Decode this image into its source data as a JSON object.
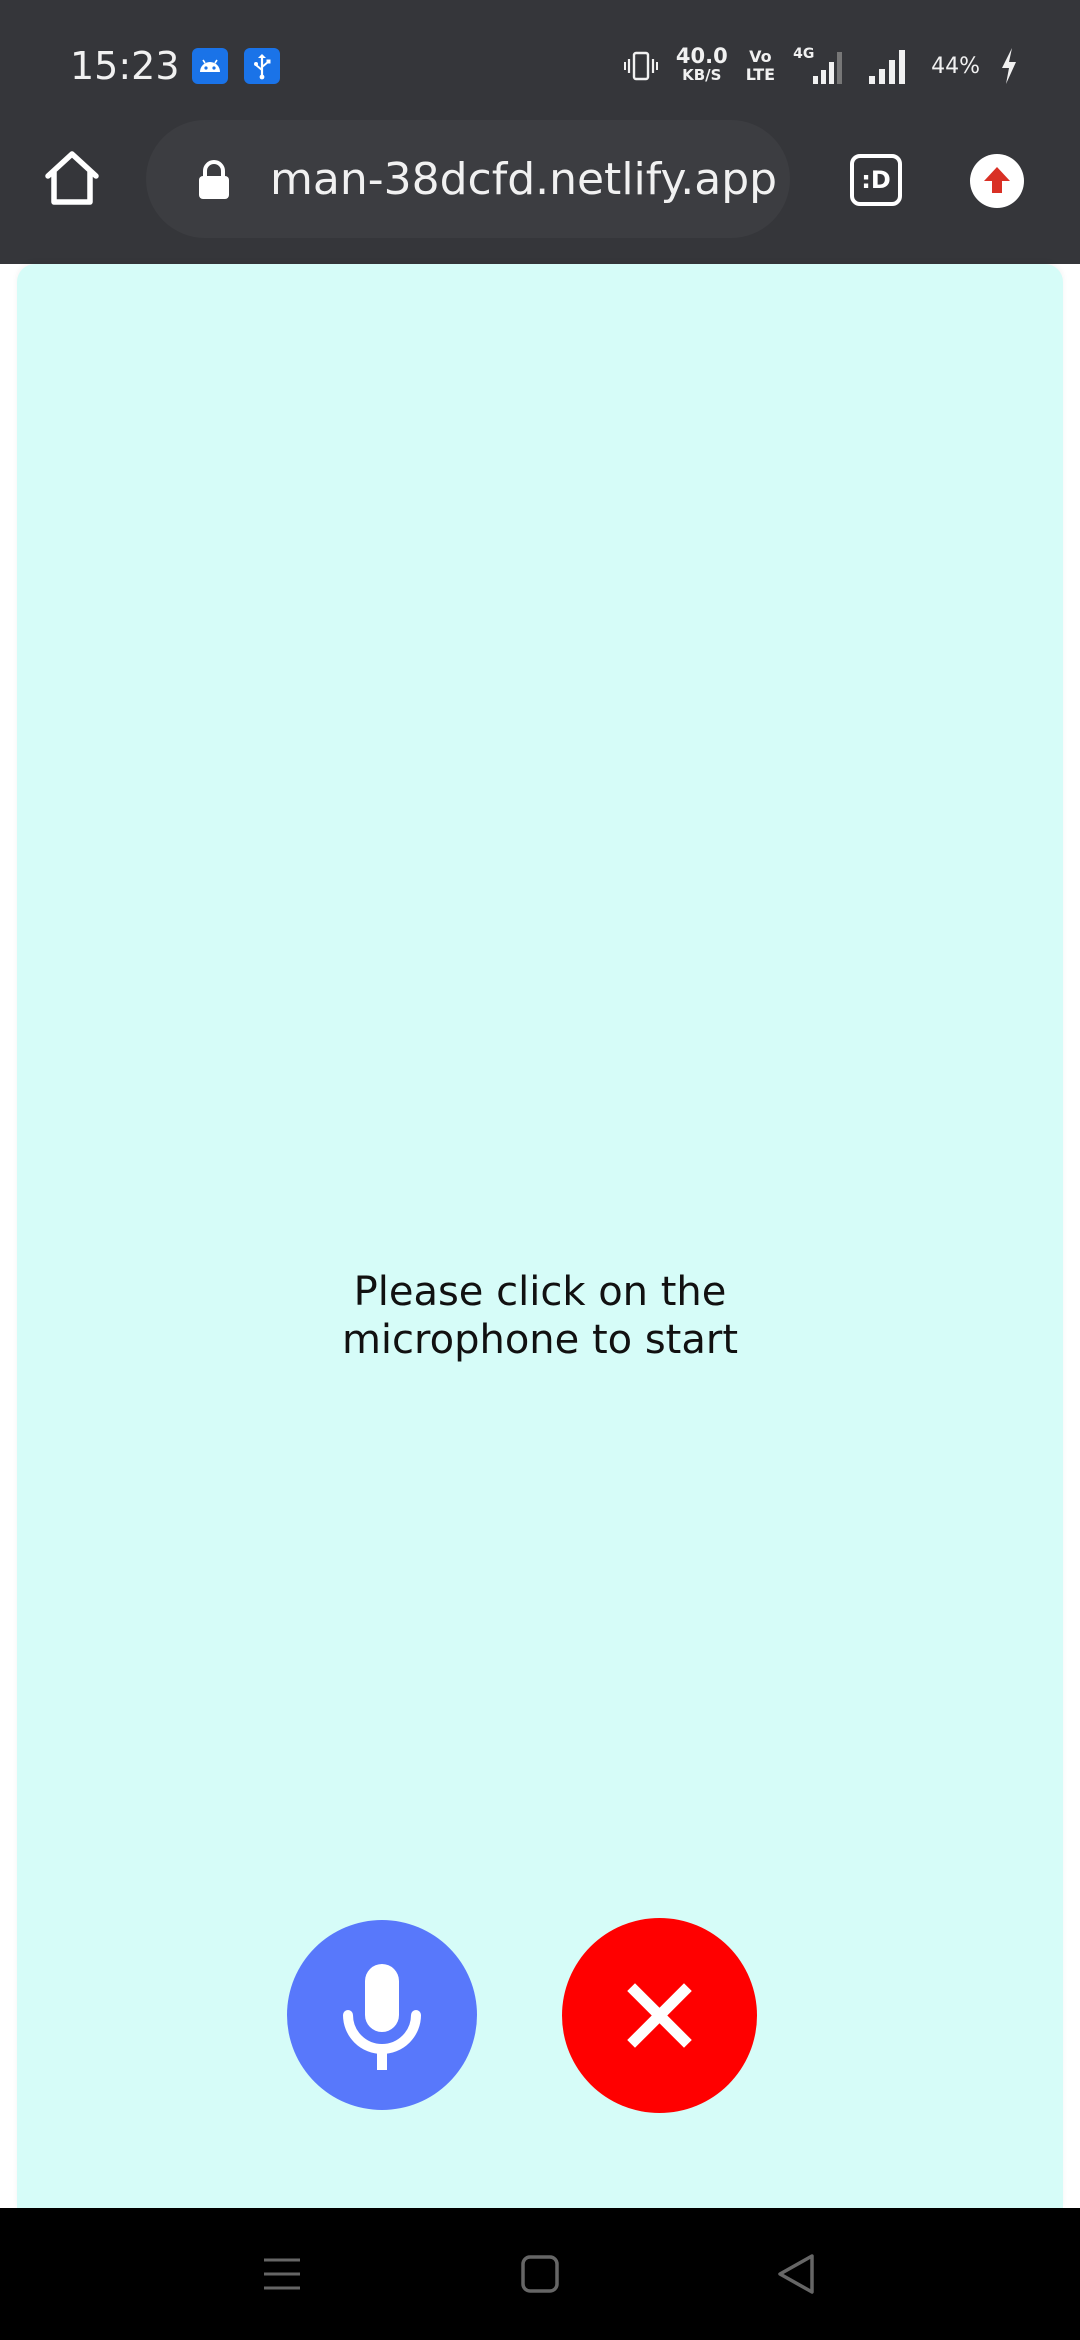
{
  "status_bar": {
    "time": "15:23",
    "net_speed_value": "40.0",
    "net_speed_unit": "KB/S",
    "volte_top": "Vo",
    "volte_bottom": "LTE",
    "network_type": "4G",
    "battery": "44%",
    "icons": [
      "android-icon",
      "usb-icon",
      "vibrate-icon",
      "signal-icon",
      "battery-charging-icon"
    ]
  },
  "browser": {
    "url": "man-38dcfd.netlify.app",
    "tabs_label": ":D",
    "icons": [
      "home-icon",
      "lock-icon",
      "update-arrow-icon"
    ]
  },
  "main": {
    "prompt": "Please click on the microphone to start",
    "icons": [
      "microphone-icon",
      "close-icon"
    ]
  },
  "colors": {
    "chrome_bar": "#35363a",
    "card_background": "#d6fcf8",
    "mic_button": "#5878fb",
    "close_button": "#ff0000"
  }
}
